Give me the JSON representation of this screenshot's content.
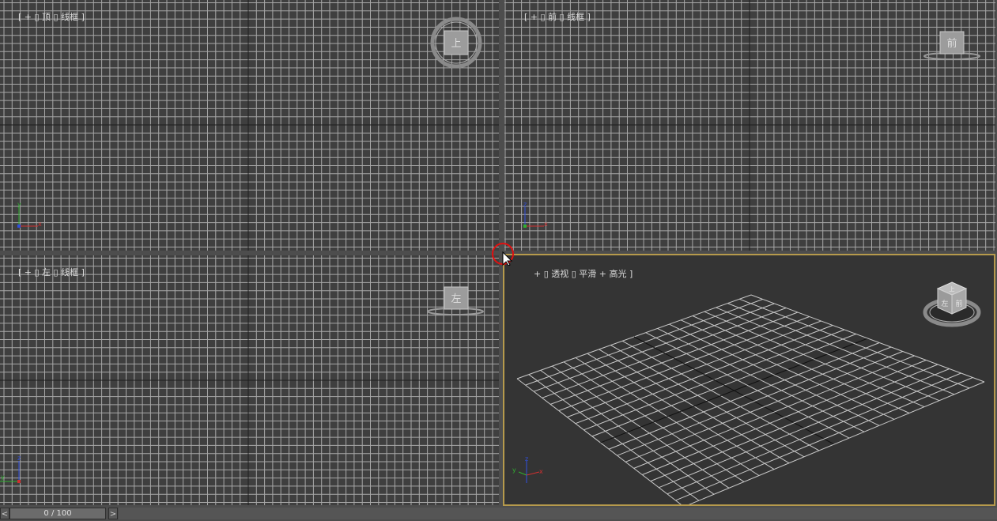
{
  "viewports": {
    "top": {
      "bracket_open": "[ ",
      "plus": "+",
      "sep": " ▯ ",
      "view": "顶",
      "sep2": " ▯ ",
      "shade": "线框",
      "bracket_close": " ]",
      "cube_face": "上"
    },
    "front": {
      "bracket_open": "[ ",
      "plus": "+",
      "sep": " ▯ ",
      "view": "前",
      "sep2": " ▯ ",
      "shade": "线框",
      "bracket_close": " ]",
      "cube_face": "前"
    },
    "left": {
      "bracket_open": "[ ",
      "plus": "+",
      "sep": " ▯ ",
      "view": "左",
      "sep2": " ▯ ",
      "shade": "线框",
      "bracket_close": " ]",
      "cube_face": "左"
    },
    "perspective": {
      "bracket_open": "[ ",
      "plus": "+",
      "sep": " ▯ ",
      "view": "透视",
      "sep2": " ▯ ",
      "shade": "平滑 + 高光",
      "bracket_close": " ]",
      "cube_faces": [
        "上",
        "左",
        "前"
      ]
    }
  },
  "axes": {
    "top": [
      "y",
      "x"
    ],
    "front": [
      "z",
      "x"
    ],
    "left": [
      "z",
      "y"
    ],
    "perspective": [
      "z",
      "y",
      "x"
    ]
  },
  "timeline": {
    "prev": "<",
    "next": ">",
    "frame_label": "0 / 100",
    "current_frame": 0,
    "total_frames": 100
  },
  "colors": {
    "active_border": "#b69a4c",
    "grid_line": "#a8a8a8",
    "axis_x": "#d03030",
    "axis_y": "#30b030",
    "axis_z": "#3050e0"
  },
  "icons": [
    "navcube-icon",
    "axis-tripod-icon",
    "mouse-cursor-icon"
  ]
}
